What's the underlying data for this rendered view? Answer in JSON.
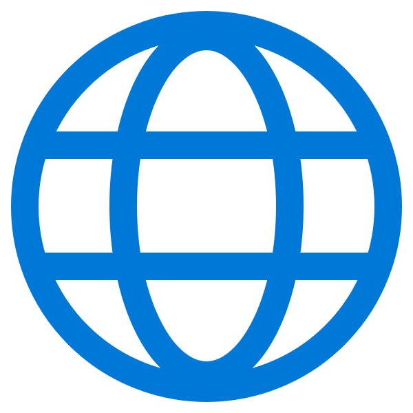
{
  "icon": {
    "name": "globe-icon",
    "color": "#0078D7"
  },
  "background": "#FFFFFF"
}
